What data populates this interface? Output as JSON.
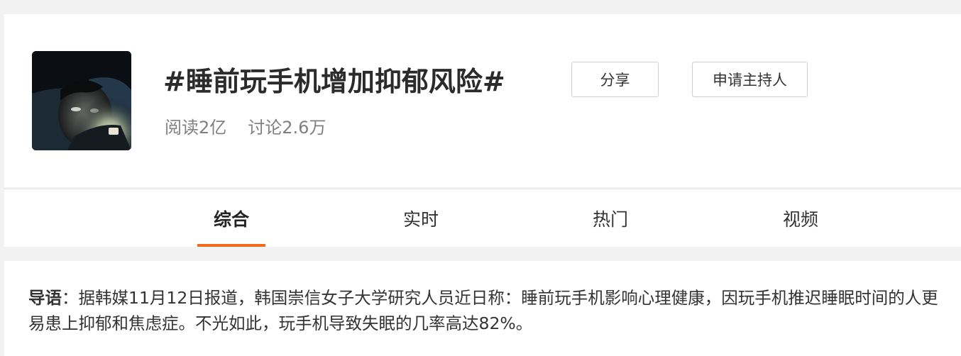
{
  "topic": {
    "title": "#睡前玩手机增加抑郁风险#",
    "reads": "阅读2亿",
    "discussions": "讨论2.6万"
  },
  "actions": {
    "share_label": "分享",
    "apply_host_label": "申请主持人"
  },
  "tabs": [
    {
      "label": "综合",
      "active": true
    },
    {
      "label": "实时",
      "active": false
    },
    {
      "label": "热门",
      "active": false
    },
    {
      "label": "视频",
      "active": false
    }
  ],
  "intro": {
    "label": "导语",
    "separator": "：",
    "text": "据韩媒11月12日报道，韩国崇信女子大学研究人员近日称：睡前玩手机影响心理健康，因玩手机推迟睡眠时间的人更易患上抑郁和焦虑症。不光如此，玩手机导致失眠的几率高达82%。"
  },
  "colors": {
    "accent": "#f26a1b",
    "background": "#f2f2f2",
    "card": "#ffffff",
    "muted_text": "#808080"
  },
  "icons": {
    "avatar": "topic-avatar-image"
  }
}
